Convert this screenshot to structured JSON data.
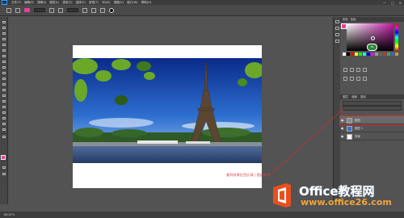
{
  "app": {
    "name": "Ps"
  },
  "menu": [
    "文件(F)",
    "编辑(E)",
    "图像(I)",
    "图层(L)",
    "类型(Y)",
    "选择(S)",
    "滤镜(T)",
    "3D(D)",
    "视图(V)",
    "窗口(W)",
    "帮助(H)"
  ],
  "window_controls": [
    "—",
    "□",
    "✕"
  ],
  "document": {
    "tab_title": ""
  },
  "canvas": {
    "caption": "看到效果红色区域 | 图层文字"
  },
  "panels": {
    "tabs": [
      "颜色",
      "色板"
    ],
    "color_badge": "59",
    "layers_tabs": [
      "图层",
      "通道",
      "路径"
    ],
    "layers": [
      {
        "name": "图层",
        "selected": true
      },
      {
        "name": "图层 1",
        "selected": false
      },
      {
        "name": "背景",
        "selected": false
      }
    ]
  },
  "status": {
    "zoom": "66.67%"
  },
  "watermark": {
    "title": "Office教程网",
    "url": "www.office26.com"
  },
  "colors": {
    "foreground": "#e8409a",
    "accent": "#d02f2f"
  }
}
